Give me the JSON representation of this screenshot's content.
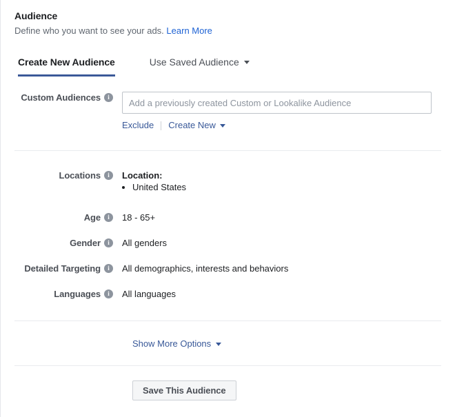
{
  "header": {
    "title": "Audience",
    "subtitle": "Define who you want to see your ads.",
    "learn_more": "Learn More"
  },
  "tabs": [
    {
      "label": "Create New Audience",
      "active": true
    },
    {
      "label": "Use Saved Audience",
      "active": false
    }
  ],
  "custom_audiences": {
    "label": "Custom Audiences",
    "input_placeholder": "Add a previously created Custom or Lookalike Audience",
    "input_value": "",
    "exclude_label": "Exclude",
    "create_new_label": "Create New"
  },
  "fields": {
    "locations": {
      "label": "Locations",
      "value_title": "Location:",
      "items": [
        "United States"
      ]
    },
    "age": {
      "label": "Age",
      "value": "18 - 65+"
    },
    "gender": {
      "label": "Gender",
      "value": "All genders"
    },
    "detailed_targeting": {
      "label": "Detailed Targeting",
      "value": "All demographics, interests and behaviors"
    },
    "languages": {
      "label": "Languages",
      "value": "All languages"
    }
  },
  "footer": {
    "show_more_options": "Show More Options",
    "save_button": "Save This Audience"
  },
  "icons": {
    "info": "i"
  },
  "colors": {
    "accent_blue": "#3b5998",
    "link_blue": "#385898",
    "learn_more_blue": "#1d62d4",
    "info_grey": "#8d949e",
    "divider": "#e9ebee"
  }
}
